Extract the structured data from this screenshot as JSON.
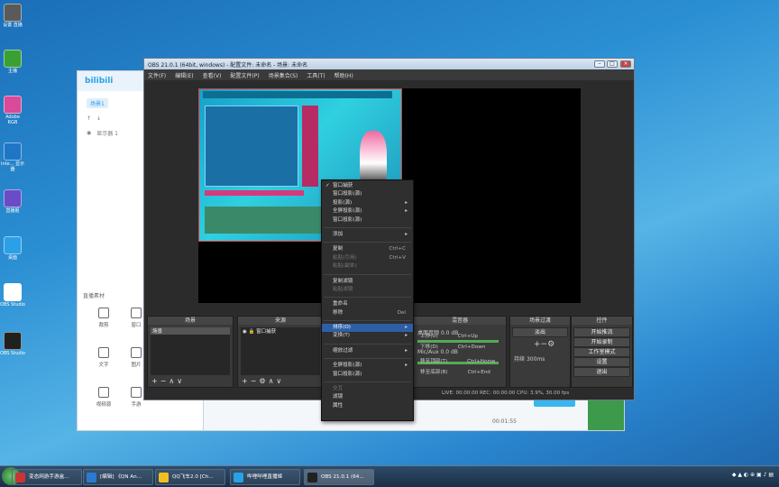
{
  "desktop": {
    "icons": [
      {
        "label": "设置\n直播",
        "color": "#5a5a5a"
      },
      {
        "label": "主播",
        "color": "#3aa035"
      },
      {
        "label": "Adobe\nRGB",
        "color": "#d84a9a"
      },
      {
        "label": "Inte...\n显示器",
        "color": "#1f76c7"
      },
      {
        "label": "直播姬",
        "color": "#6b4cc7"
      },
      {
        "label": "桌面",
        "color": "#2aa1e6"
      },
      {
        "label": "OBS Studio",
        "color": "#ffffff"
      },
      {
        "label": "OBS Studio",
        "color": "#202020"
      }
    ]
  },
  "bili": {
    "logo": "bilibili",
    "scene_tab": "场景1",
    "source_item": "显示器 1",
    "section_label": "直播素材",
    "tools": [
      "裁剪",
      "窗口",
      "文字",
      "图片",
      "视频源",
      "手游"
    ]
  },
  "player": {
    "time": "00:01:55"
  },
  "obs": {
    "title": "OBS 21.0.1 (64bit, windows) - 配置文件: 未命名 - 场景: 未命名",
    "menus": [
      "文件(F)",
      "编辑(E)",
      "查看(V)",
      "配置文件(P)",
      "场景集合(S)",
      "工具(T)",
      "帮助(H)"
    ],
    "docks": {
      "scenes": {
        "title": "场景",
        "items": [
          "场景"
        ]
      },
      "sources": {
        "title": "来源",
        "items": [
          "窗口捕获"
        ]
      },
      "mixer": {
        "title": "混音器",
        "rows": [
          {
            "name": "桌面音频",
            "value": "0.0 dB"
          },
          {
            "name": "Mic/Aux",
            "value": "0.0 dB"
          }
        ]
      },
      "transitions": {
        "title": "场景过渡",
        "select": "淡出",
        "duration_label": "持续",
        "duration": "300ms"
      },
      "controls": {
        "title": "控件",
        "buttons": [
          "开始推流",
          "开始录制",
          "工作室模式",
          "设置",
          "退出"
        ]
      }
    },
    "status": "LIVE: 00:00:00   REC: 00:00:00   CPU: 3.9%, 30.00 fps"
  },
  "context_menu": {
    "items": [
      {
        "label": "窗口捕获",
        "type": "check"
      },
      {
        "label": "窗口投影(源)",
        "type": "normal",
        "shortcut": ""
      },
      {
        "label": "投影(源)",
        "type": "submenu"
      },
      {
        "label": "全屏投影(源)",
        "type": "submenu"
      },
      {
        "label": "窗口投影(源)",
        "type": "normal"
      },
      {
        "label": "sep"
      },
      {
        "label": "添加",
        "type": "submenu"
      },
      {
        "label": "sep"
      },
      {
        "label": "复制",
        "type": "normal",
        "shortcut": "Ctrl+C"
      },
      {
        "label": "粘贴(引用)",
        "type": "disabled",
        "shortcut": "Ctrl+V"
      },
      {
        "label": "粘贴(副本)",
        "type": "disabled"
      },
      {
        "label": "sep"
      },
      {
        "label": "复制滤镜",
        "type": "normal"
      },
      {
        "label": "粘贴滤镜",
        "type": "disabled"
      },
      {
        "label": "sep"
      },
      {
        "label": "重命名",
        "type": "normal"
      },
      {
        "label": "移除",
        "type": "normal",
        "shortcut": "Del"
      },
      {
        "label": "sep"
      },
      {
        "label": "排序(O)",
        "type": "selected"
      },
      {
        "label": "变换(T)",
        "type": "submenu"
      },
      {
        "label": "sep"
      },
      {
        "label": "缩放过滤",
        "type": "submenu"
      },
      {
        "label": "sep"
      },
      {
        "label": "全屏投影(源)",
        "type": "submenu"
      },
      {
        "label": "窗口投影(源)",
        "type": "normal"
      },
      {
        "label": "sep"
      },
      {
        "label": "交互",
        "type": "disabled"
      },
      {
        "label": "滤镜",
        "type": "normal"
      },
      {
        "label": "属性",
        "type": "normal"
      }
    ],
    "sub_shortcuts": [
      "Ctrl+Up",
      "Ctrl+Down",
      "Ctrl+Home",
      "Ctrl+End"
    ],
    "sub_labels": [
      "上移(U)",
      "下移(D)",
      "移至顶部(T)",
      "移至底部(B)"
    ]
  },
  "taskbar": {
    "tasks": [
      {
        "label": "变态网游手游盒...",
        "color": "#c33"
      },
      {
        "label": "[编辑] 《QN An...",
        "color": "#2a7bd0"
      },
      {
        "label": "QQ飞车2.0 [Ch...",
        "color": "#f0c020"
      },
      {
        "label": "哔哩哔哩直播姬",
        "color": "#2aa1e6"
      },
      {
        "label": "OBS 21.0.1 (64...",
        "color": "#222"
      }
    ]
  }
}
